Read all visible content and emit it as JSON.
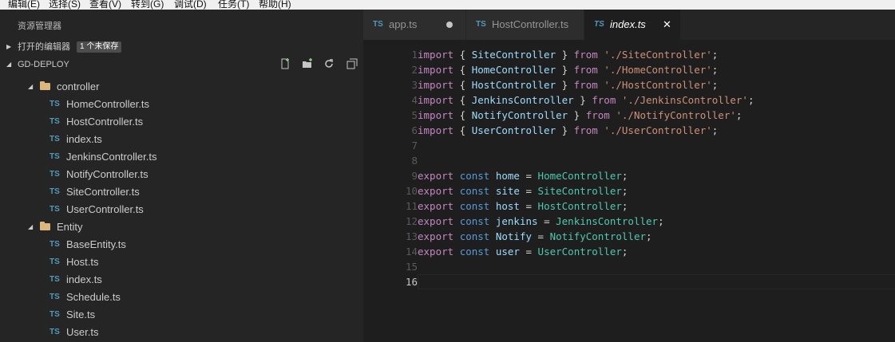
{
  "menu": [
    "编辑(E)",
    "选择(S)",
    "查看(V)",
    "转到(G)",
    "调试(D)",
    "任务(T)",
    "帮助(H)"
  ],
  "sidebar": {
    "title": "资源管理器",
    "open_editors": {
      "label": "打开的编辑器",
      "badge": "1 个未保存"
    },
    "project": {
      "label": "GD-DEPLOY"
    },
    "folders": [
      {
        "name": "controller",
        "files": [
          "HomeController.ts",
          "HostController.ts",
          "index.ts",
          "JenkinsController.ts",
          "NotifyController.ts",
          "SiteController.ts",
          "UserController.ts"
        ]
      },
      {
        "name": "Entity",
        "files": [
          "BaseEntity.ts",
          "Host.ts",
          "index.ts",
          "Schedule.ts",
          "Site.ts",
          "User.ts"
        ]
      }
    ],
    "file_icon_text": "TS"
  },
  "tabs": [
    {
      "label": "app.ts",
      "icon": "TS",
      "dirty": true,
      "active": false
    },
    {
      "label": "HostController.ts",
      "icon": "TS",
      "dirty": false,
      "active": false
    },
    {
      "label": "index.ts",
      "icon": "TS",
      "dirty": false,
      "active": true
    }
  ],
  "editor": {
    "current_line": 16,
    "lines": [
      [
        [
          "kw",
          "import"
        ],
        [
          "pun",
          " { "
        ],
        [
          "id",
          "SiteController"
        ],
        [
          "pun",
          " } "
        ],
        [
          "kw",
          "from"
        ],
        [
          "pun",
          " "
        ],
        [
          "str",
          "'./SiteController'"
        ],
        [
          "pun",
          ";"
        ]
      ],
      [
        [
          "kw",
          "import"
        ],
        [
          "pun",
          " { "
        ],
        [
          "id",
          "HomeController"
        ],
        [
          "pun",
          " } "
        ],
        [
          "kw",
          "from"
        ],
        [
          "pun",
          " "
        ],
        [
          "str",
          "'./HomeController'"
        ],
        [
          "pun",
          ";"
        ]
      ],
      [
        [
          "kw",
          "import"
        ],
        [
          "pun",
          " { "
        ],
        [
          "id",
          "HostController"
        ],
        [
          "pun",
          " } "
        ],
        [
          "kw",
          "from"
        ],
        [
          "pun",
          " "
        ],
        [
          "str",
          "'./HostController'"
        ],
        [
          "pun",
          ";"
        ]
      ],
      [
        [
          "kw",
          "import"
        ],
        [
          "pun",
          " { "
        ],
        [
          "id",
          "JenkinsController"
        ],
        [
          "pun",
          " } "
        ],
        [
          "kw",
          "from"
        ],
        [
          "pun",
          " "
        ],
        [
          "str",
          "'./JenkinsController'"
        ],
        [
          "pun",
          ";"
        ]
      ],
      [
        [
          "kw",
          "import"
        ],
        [
          "pun",
          " { "
        ],
        [
          "id",
          "NotifyController"
        ],
        [
          "pun",
          " } "
        ],
        [
          "kw",
          "from"
        ],
        [
          "pun",
          " "
        ],
        [
          "str",
          "'./NotifyController'"
        ],
        [
          "pun",
          ";"
        ]
      ],
      [
        [
          "kw",
          "import"
        ],
        [
          "pun",
          " { "
        ],
        [
          "id",
          "UserController"
        ],
        [
          "pun",
          " } "
        ],
        [
          "kw",
          "from"
        ],
        [
          "pun",
          " "
        ],
        [
          "str",
          "'./UserController'"
        ],
        [
          "pun",
          ";"
        ]
      ],
      [],
      [],
      [
        [
          "kw",
          "export"
        ],
        [
          "pun",
          " "
        ],
        [
          "kw2",
          "const"
        ],
        [
          "pun",
          " "
        ],
        [
          "id",
          "home"
        ],
        [
          "pun",
          " = "
        ],
        [
          "cls",
          "HomeController"
        ],
        [
          "pun",
          ";"
        ]
      ],
      [
        [
          "kw",
          "export"
        ],
        [
          "pun",
          " "
        ],
        [
          "kw2",
          "const"
        ],
        [
          "pun",
          " "
        ],
        [
          "id",
          "site"
        ],
        [
          "pun",
          " = "
        ],
        [
          "cls",
          "SiteController"
        ],
        [
          "pun",
          ";"
        ]
      ],
      [
        [
          "kw",
          "export"
        ],
        [
          "pun",
          " "
        ],
        [
          "kw2",
          "const"
        ],
        [
          "pun",
          " "
        ],
        [
          "id",
          "host"
        ],
        [
          "pun",
          " = "
        ],
        [
          "cls",
          "HostController"
        ],
        [
          "pun",
          ";"
        ]
      ],
      [
        [
          "kw",
          "export"
        ],
        [
          "pun",
          " "
        ],
        [
          "kw2",
          "const"
        ],
        [
          "pun",
          " "
        ],
        [
          "id",
          "jenkins"
        ],
        [
          "pun",
          " = "
        ],
        [
          "cls",
          "JenkinsController"
        ],
        [
          "pun",
          ";"
        ]
      ],
      [
        [
          "kw",
          "export"
        ],
        [
          "pun",
          " "
        ],
        [
          "kw2",
          "const"
        ],
        [
          "pun",
          " "
        ],
        [
          "id",
          "Notify"
        ],
        [
          "pun",
          " = "
        ],
        [
          "cls",
          "NotifyController"
        ],
        [
          "pun",
          ";"
        ]
      ],
      [
        [
          "kw",
          "export"
        ],
        [
          "pun",
          " "
        ],
        [
          "kw2",
          "const"
        ],
        [
          "pun",
          " "
        ],
        [
          "id",
          "user"
        ],
        [
          "pun",
          " = "
        ],
        [
          "cls",
          "UserController"
        ],
        [
          "pun",
          ";"
        ]
      ],
      [],
      []
    ]
  }
}
